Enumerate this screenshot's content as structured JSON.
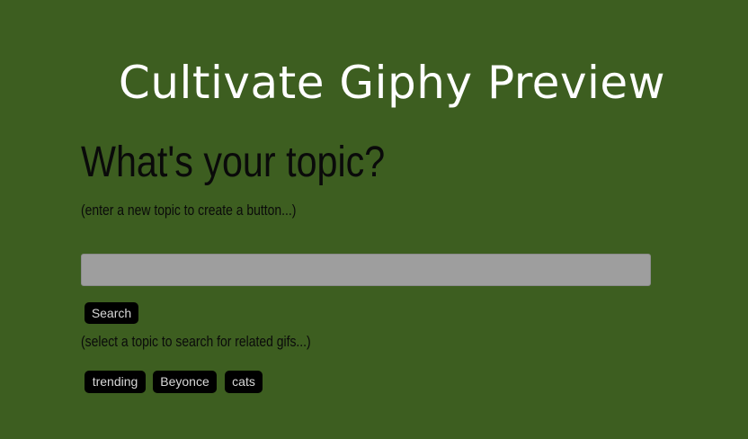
{
  "page": {
    "title": "Cultivate Giphy Preview",
    "heading": "What's your topic?",
    "create_hint": "(enter a new topic to create a button...)",
    "select_hint": "(select a topic to search for related gifs...)"
  },
  "search": {
    "input_value": "",
    "button_label": "Search"
  },
  "topics": [
    "trending",
    "Beyonce",
    "cats"
  ],
  "colors": {
    "background": "#3d5e20",
    "title_text": "#ffffff",
    "button_bg": "#000000",
    "input_bg": "#9e9e9e"
  }
}
